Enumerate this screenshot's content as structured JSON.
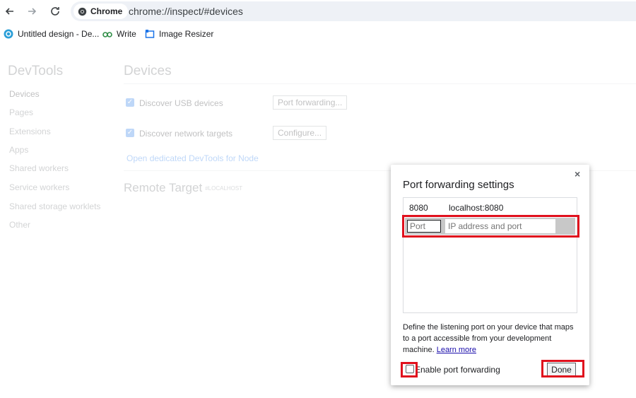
{
  "browser": {
    "chip_label": "Chrome",
    "url": "chrome://inspect/#devices",
    "bookmarks": [
      {
        "label": "Untitled design - De...",
        "icon": "canva-icon"
      },
      {
        "label": "Write",
        "icon": "geeksforgeeks-icon"
      },
      {
        "label": "Image Resizer",
        "icon": "image-resizer-icon"
      }
    ]
  },
  "sidebar": {
    "title": "DevTools",
    "items": [
      {
        "label": "Devices"
      },
      {
        "label": "Pages"
      },
      {
        "label": "Extensions"
      },
      {
        "label": "Apps"
      },
      {
        "label": "Shared workers"
      },
      {
        "label": "Service workers"
      },
      {
        "label": "Shared storage worklets"
      },
      {
        "label": "Other"
      }
    ]
  },
  "main": {
    "title": "Devices",
    "usb_label": "Discover USB devices",
    "port_forwarding_button": "Port forwarding...",
    "network_label": "Discover network targets",
    "configure_button": "Configure...",
    "node_link": "Open dedicated DevTools for Node",
    "remote_title": "Remote Target",
    "remote_sub": "#LOCALHOST"
  },
  "dialog": {
    "close": "×",
    "title": "Port forwarding settings",
    "rule": {
      "port": "8080",
      "address": "localhost:8080"
    },
    "port_placeholder": "Port",
    "address_placeholder": "IP address and port",
    "description": "Define the listening port on your device that maps to a port accessible from your development machine.",
    "learn_more": "Learn more",
    "enable_label": "Enable port forwarding",
    "enable_checked": false,
    "done_button": "Done"
  },
  "colors": {
    "highlight": "#e0101d",
    "accent": "#1a73e8"
  }
}
